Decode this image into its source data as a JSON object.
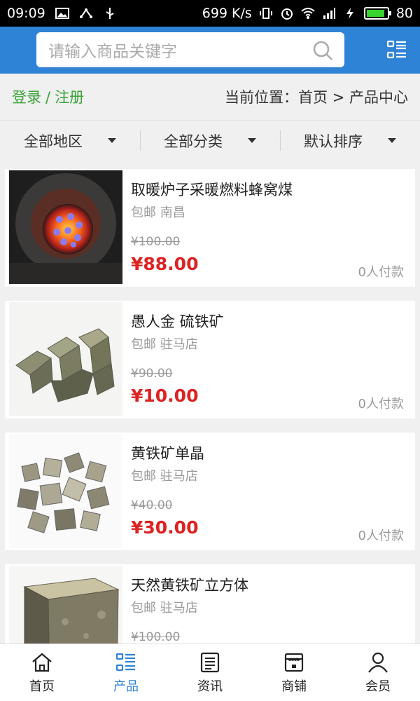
{
  "status_bar": {
    "time": "09:09",
    "net_speed": "699 K/s",
    "battery": "80"
  },
  "search": {
    "placeholder": "请输入商品关键字"
  },
  "locbar": {
    "login": "登录",
    "sep": "/",
    "register": "注册",
    "location": "当前位置：首页 > 产品中心"
  },
  "filters": [
    {
      "label": "全部地区"
    },
    {
      "label": "全部分类"
    },
    {
      "label": "默认排序"
    }
  ],
  "products": [
    {
      "title": "取暖炉子采暖燃料蜂窝煤",
      "shipping": "包邮 南昌",
      "old_price": "¥100.00",
      "price": "¥88.00",
      "sales": "0人付款",
      "image": "honeycomb-coal-stove"
    },
    {
      "title": "愚人金 硫铁矿",
      "shipping": "包邮 驻马店",
      "old_price": "¥90.00",
      "price": "¥10.00",
      "sales": "0人付款",
      "image": "pyrite-cluster"
    },
    {
      "title": "黄铁矿单晶",
      "shipping": "包邮 驻马店",
      "old_price": "¥40.00",
      "price": "¥30.00",
      "sales": "0人付款",
      "image": "pyrite-crystals"
    },
    {
      "title": "天然黄铁矿立方体",
      "shipping": "包邮 驻马店",
      "old_price": "¥100.00",
      "price": "",
      "sales": "",
      "image": "pyrite-cube"
    }
  ],
  "tabs": [
    {
      "label": "首页",
      "icon": "home-icon"
    },
    {
      "label": "产品",
      "icon": "products-icon"
    },
    {
      "label": "资讯",
      "icon": "news-icon"
    },
    {
      "label": "商铺",
      "icon": "shop-icon"
    },
    {
      "label": "会员",
      "icon": "member-icon"
    }
  ],
  "colors": {
    "header_blue": "#2f83d6",
    "login_green": "#3aa33a",
    "price_red": "#dd2222"
  }
}
